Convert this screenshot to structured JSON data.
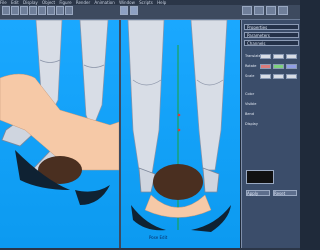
{
  "menubar": {
    "items": [
      "File",
      "Edit",
      "Display",
      "Object",
      "Figure",
      "Render",
      "Animation",
      "Window",
      "Scripts",
      "Help"
    ]
  },
  "toolbar": {
    "buttons": [
      "select-tool",
      "move-tool",
      "rotate-tool",
      "scale-tool",
      "zoom-tool",
      "camera-tool",
      "light-tool",
      "render-tool"
    ]
  },
  "viewports": {
    "left": {
      "label": ""
    },
    "right": {
      "label": "Pose Edit"
    }
  },
  "panel": {
    "tabs": [
      "Properties",
      "Parameters",
      "Channels"
    ],
    "rows": [
      "Translate",
      "Rotate",
      "Scale",
      "Color",
      "Visible",
      "Bend",
      "Display"
    ],
    "buttons": [
      "Apply",
      "Reset"
    ]
  },
  "colors": {
    "viewport_bg": "#14a7ff",
    "panel_bg": "#3b4d6a",
    "toolbar_bg": "#3d4a5f"
  }
}
